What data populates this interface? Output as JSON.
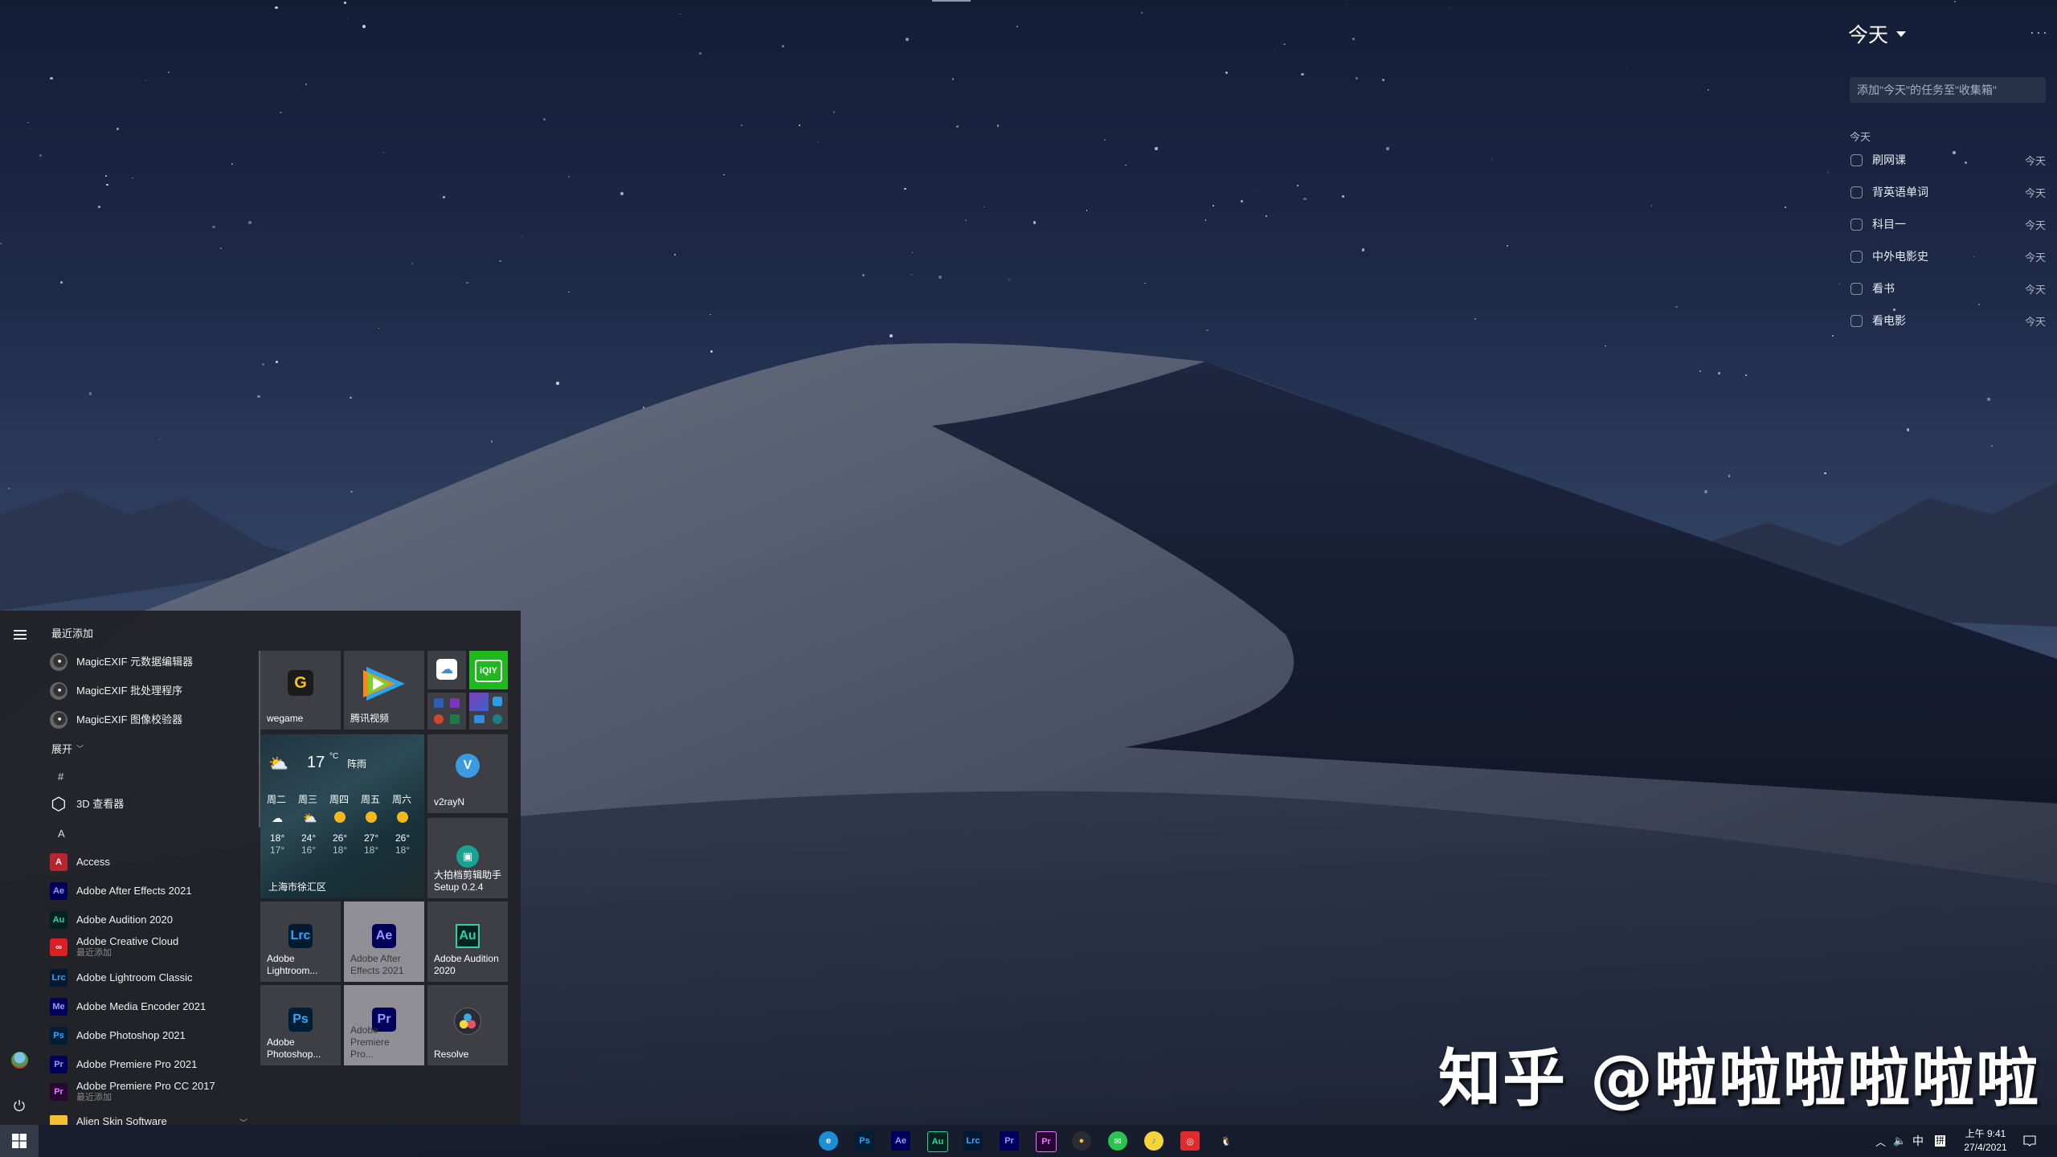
{
  "todo": {
    "title": "今天",
    "more": "···",
    "add_placeholder": "添加\"今天\"的任务至\"收集箱\"",
    "section": "今天",
    "tasks": [
      {
        "text": "刷网课",
        "due": "今天",
        "done": false
      },
      {
        "text": "背英语单词",
        "due": "今天",
        "done": false
      },
      {
        "text": "科目一",
        "due": "今天",
        "done": false
      },
      {
        "text": "中外电影史",
        "due": "今天",
        "done": false
      },
      {
        "text": "看书",
        "due": "今天",
        "done": false
      },
      {
        "text": "看电影",
        "due": "今天",
        "done": false
      }
    ]
  },
  "watermark": "知乎 @啦啦啦啦啦啦",
  "start_menu": {
    "recent_header": "最近添加",
    "recent": [
      {
        "label": "MagicEXIF 元数据编辑器",
        "icon": "magicexif-icon"
      },
      {
        "label": "MagicEXIF 批处理程序",
        "icon": "magicexif-icon"
      },
      {
        "label": "MagicEXIF 图像校验器",
        "icon": "magicexif-verifier-icon"
      }
    ],
    "expand_label": "展开",
    "groups": [
      {
        "letter": "#",
        "items": [
          {
            "label": "3D 查看器",
            "icon": "3d-viewer-icon",
            "glyph": "⬡"
          }
        ]
      },
      {
        "letter": "A",
        "items": [
          {
            "label": "Access",
            "icon": "access-icon",
            "glyph": "A",
            "color": "#b7262f",
            "fg": "#fff"
          },
          {
            "label": "Adobe After Effects 2021",
            "icon": "after-effects-icon",
            "glyph": "Ae",
            "color": "#00005b",
            "fg": "#9999ff"
          },
          {
            "label": "Adobe Audition 2020",
            "icon": "audition-icon",
            "glyph": "Au",
            "color": "#00231f",
            "fg": "#2fd1a4"
          },
          {
            "label": "Adobe Creative Cloud",
            "sub": "最近添加",
            "icon": "creative-cloud-icon",
            "glyph": "∞",
            "color": "#da1f26",
            "fg": "#fff"
          },
          {
            "label": "Adobe Lightroom Classic",
            "icon": "lightroom-classic-icon",
            "glyph": "Lrc",
            "color": "#001a32",
            "fg": "#31a8ff"
          },
          {
            "label": "Adobe Media Encoder 2021",
            "icon": "media-encoder-icon",
            "glyph": "Me",
            "color": "#00005b",
            "fg": "#9999ff"
          },
          {
            "label": "Adobe Photoshop 2021",
            "icon": "photoshop-icon",
            "glyph": "Ps",
            "color": "#001e36",
            "fg": "#31a8ff"
          },
          {
            "label": "Adobe Premiere Pro 2021",
            "icon": "premiere-pro-icon",
            "glyph": "Pr",
            "color": "#00005b",
            "fg": "#9999ff"
          },
          {
            "label": "Adobe Premiere Pro CC 2017",
            "sub": "最近添加",
            "icon": "premiere-pro-cc-icon",
            "glyph": "Pr",
            "color": "#2a0634",
            "fg": "#e577ff"
          },
          {
            "label": "Alien Skin Software",
            "icon": "folder-icon",
            "glyph": "",
            "color": "#f2c031",
            "fg": "#fff"
          }
        ]
      }
    ],
    "tiles": {
      "wegame": "wegame",
      "tencent_video": "腾讯视频",
      "iqiyi": "iQIY",
      "v2rayn": "v2rayN",
      "dapaidang": "大拍档剪辑助手 Setup 0.2.4",
      "lightroom": "Adobe Lightroom...",
      "after_effects": "Adobe After Effects 2021",
      "audition": "Adobe Audition 2020",
      "photoshop": "Adobe Photoshop...",
      "premiere": "Adobe Premiere Pro...",
      "resolve": "Resolve"
    },
    "weather": {
      "temp": "17",
      "unit": "°C",
      "condition": "阵雨",
      "location": "上海市徐汇区",
      "forecast": [
        {
          "day": "周二",
          "high": "18°",
          "low": "17°",
          "icon": "rain-cloud-icon"
        },
        {
          "day": "周三",
          "high": "24°",
          "low": "16°",
          "icon": "partly-cloudy-icon"
        },
        {
          "day": "周四",
          "high": "26°",
          "low": "18°",
          "icon": "sun-icon"
        },
        {
          "day": "周五",
          "high": "27°",
          "low": "18°",
          "icon": "sun-icon"
        },
        {
          "day": "周六",
          "high": "26°",
          "low": "18°",
          "icon": "sun-icon"
        }
      ]
    }
  },
  "taskbar": {
    "apps": [
      {
        "name": "edge",
        "glyph": "e",
        "color": "#1b8fd6",
        "fg": "#fff"
      },
      {
        "name": "photoshop",
        "glyph": "Ps",
        "color": "#001e36",
        "fg": "#31a8ff"
      },
      {
        "name": "after-effects",
        "glyph": "Ae",
        "color": "#00005b",
        "fg": "#9999ff"
      },
      {
        "name": "audition",
        "glyph": "Au",
        "color": "#00231f",
        "fg": "#2fd1a4"
      },
      {
        "name": "lightroom-classic",
        "glyph": "Lrc",
        "color": "#001a32",
        "fg": "#31a8ff"
      },
      {
        "name": "premiere-pro",
        "glyph": "Pr",
        "color": "#00005b",
        "fg": "#9999ff"
      },
      {
        "name": "premiere-pro-cc",
        "glyph": "Pr",
        "color": "#2a0634",
        "fg": "#e577ff"
      },
      {
        "name": "davinci-resolve",
        "glyph": "●",
        "color": "#2b2b33",
        "fg": "#f2c031"
      },
      {
        "name": "wechat",
        "glyph": "✉",
        "color": "#2bc24f",
        "fg": "#fff"
      },
      {
        "name": "qq-music",
        "glyph": "♪",
        "color": "#f7d53a",
        "fg": "#21a05b"
      },
      {
        "name": "netease-music",
        "glyph": "◎",
        "color": "#e22a2a",
        "fg": "#fff"
      },
      {
        "name": "qq",
        "glyph": "🐧",
        "color": "transparent",
        "fg": "#fff"
      }
    ],
    "tray": {
      "ime_lang": "中",
      "ime_mode": "拼",
      "time": "上午 9:41",
      "date": "27/4/2021"
    }
  }
}
